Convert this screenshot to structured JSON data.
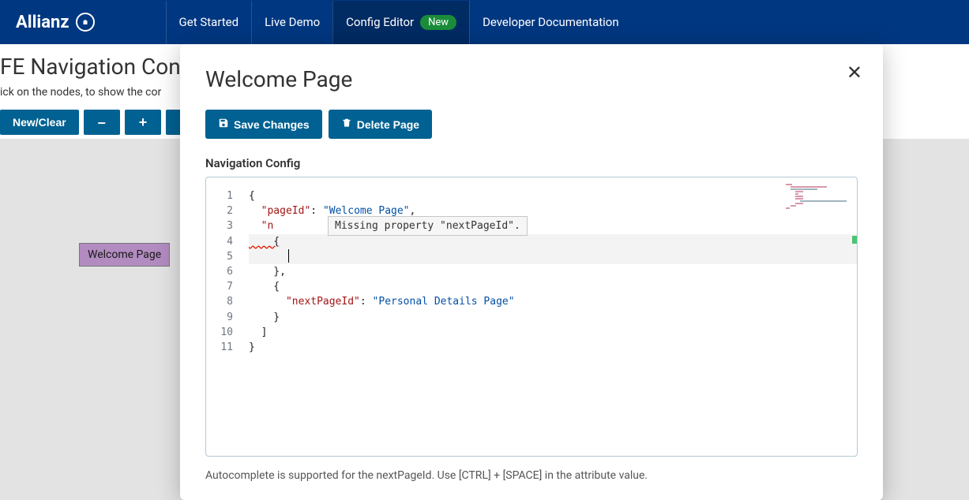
{
  "brand": "Allianz",
  "nav": [
    {
      "label": "Get Started"
    },
    {
      "label": "Live Demo"
    },
    {
      "label": "Config Editor",
      "badge": "New",
      "active": true
    },
    {
      "label": "Developer Documentation"
    }
  ],
  "page": {
    "title": "FE Navigation Conf",
    "subtitle": "ick on the nodes, to show the cor",
    "toolbar": {
      "newClear": "New/Clear",
      "minus": "–",
      "plus": "+"
    }
  },
  "node": {
    "label": "Welcome Page"
  },
  "modal": {
    "title": "Welcome Page",
    "saveLabel": "Save Changes",
    "deleteLabel": "Delete Page",
    "sectionLabel": "Navigation Config",
    "tooltip": "Missing property \"nextPageId\".",
    "hint": "Autocomplete is supported for the nextPageId. Use [CTRL] + [SPACE] in the attribute value.",
    "lineNumbers": [
      "1",
      "2",
      "3",
      "4",
      "5",
      "6",
      "7",
      "8",
      "9",
      "10",
      "11"
    ],
    "code": {
      "l1": "{",
      "l2_k": "\"pageId\"",
      "l2_c": ": ",
      "l2_v": "\"Welcome Page\"",
      "l2_e": ",",
      "l3_k": "\"n",
      "l3_rest": "",
      "l4": "    {",
      "l5": "",
      "l6": "    },",
      "l7": "    {",
      "l8_k": "\"nextPageId\"",
      "l8_c": ": ",
      "l8_v": "\"Personal Details Page\"",
      "l9": "    }",
      "l10": "  ]",
      "l11": "}"
    }
  }
}
